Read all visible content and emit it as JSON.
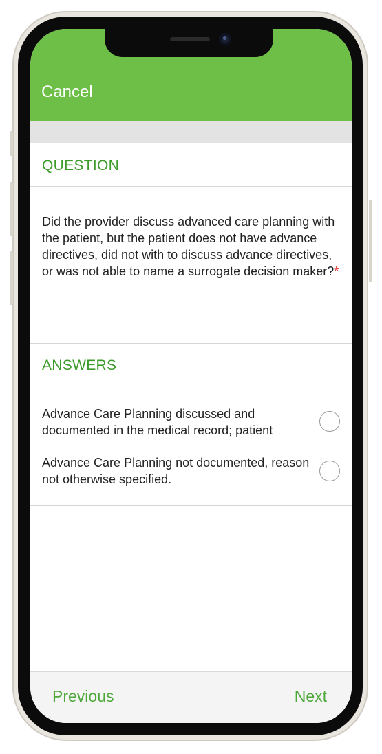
{
  "header": {
    "cancel_label": "Cancel",
    "bar_color": "#6dbf47"
  },
  "question": {
    "heading": "QUESTION",
    "text": "Did the provider discuss advanced care planning with the patient, but the patient does not have advance directives, did not with to discuss advance directives, or was not able to name a surrogate decision maker?",
    "required_marker": "*"
  },
  "answers": {
    "heading": "ANSWERS",
    "options": [
      {
        "label": "Advance Care Planning discussed and documented in the medical record; patient",
        "selected": false
      },
      {
        "label": "Advance Care Planning not documented, reason not otherwise specified.",
        "selected": false
      }
    ]
  },
  "footer": {
    "previous_label": "Previous",
    "next_label": "Next"
  },
  "colors": {
    "accent": "#3c9b2a",
    "required": "#e02020"
  }
}
